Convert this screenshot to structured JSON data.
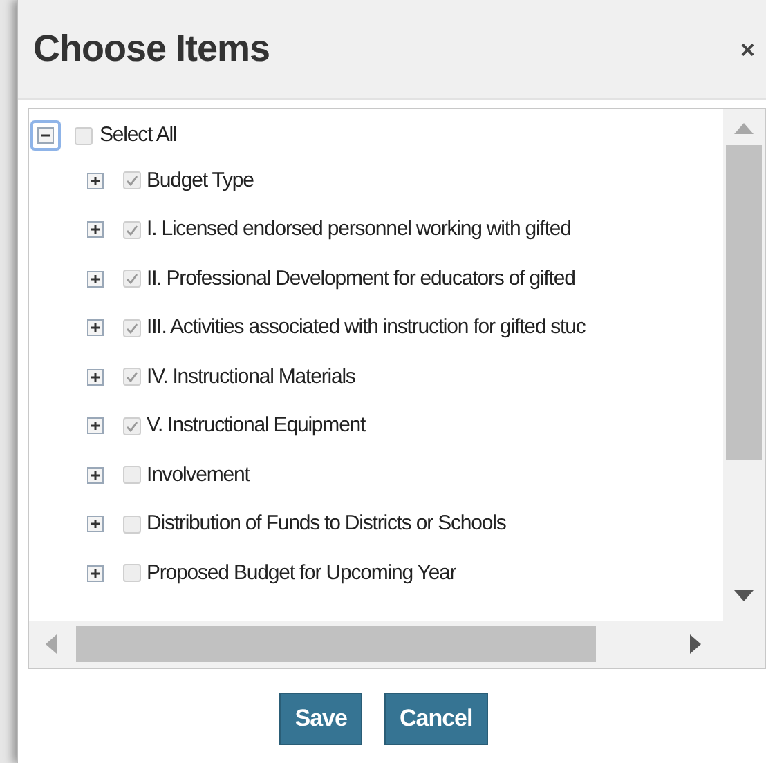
{
  "dialog": {
    "title": "Choose Items",
    "close": "×"
  },
  "tree": {
    "root": {
      "label": "Select All",
      "checked": false,
      "expanded": true,
      "focused": true
    },
    "items": [
      {
        "label": "Budget Type",
        "checked": true,
        "expanded": false
      },
      {
        "label": "I. Licensed endorsed personnel working with gifted",
        "checked": true,
        "expanded": false
      },
      {
        "label": "II. Professional Development for educators of gifted",
        "checked": true,
        "expanded": false
      },
      {
        "label": "III. Activities associated with instruction for gifted stuc",
        "checked": true,
        "expanded": false
      },
      {
        "label": "IV. Instructional Materials",
        "checked": true,
        "expanded": false
      },
      {
        "label": "V. Instructional Equipment",
        "checked": true,
        "expanded": false
      },
      {
        "label": "Involvement",
        "checked": false,
        "expanded": false
      },
      {
        "label": "Distribution of Funds to Districts or Schools",
        "checked": false,
        "expanded": false
      },
      {
        "label": "Proposed Budget for Upcoming Year",
        "checked": false,
        "expanded": false
      }
    ]
  },
  "buttons": [
    {
      "label": "Save"
    },
    {
      "label": "Cancel"
    }
  ]
}
